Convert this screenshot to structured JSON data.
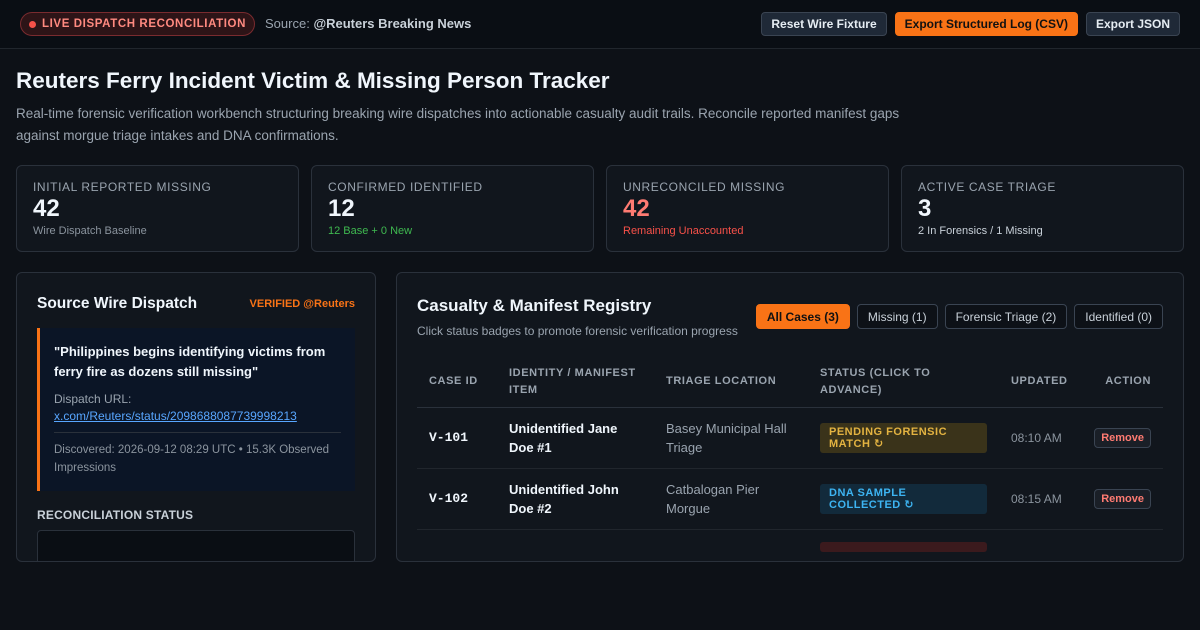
{
  "topbar": {
    "live_label": "LIVE DISPATCH RECONCILIATION",
    "source_prefix": "Source:",
    "source_handle": "@Reuters Breaking News",
    "buttons": {
      "reset": "Reset Wire Fixture",
      "export_csv": "Export Structured Log (CSV)",
      "export_json": "Export JSON"
    }
  },
  "header": {
    "title": "Reuters Ferry Incident Victim & Missing Person Tracker",
    "description": "Real-time forensic verification workbench structuring breaking wire dispatches into actionable casualty audit trails. Reconcile reported manifest gaps against morgue triage intakes and DNA confirmations."
  },
  "stats": [
    {
      "label": "Initial Reported Missing",
      "value": "42",
      "sub": "Wire Dispatch Baseline"
    },
    {
      "label": "Confirmed Identified",
      "value": "12",
      "sub": "12 Base + 0 New"
    },
    {
      "label": "Unreconciled Missing",
      "value": "42",
      "sub": "Remaining Unaccounted"
    },
    {
      "label": "Active Case Triage",
      "value": "3",
      "sub": "2 In Forensics / 1 Missing"
    }
  ],
  "dispatch": {
    "title": "Source Wire Dispatch",
    "verified": "VERIFIED @Reuters",
    "quote": "\"Philippines begins identifying victims from ferry fire as dozens still missing\"",
    "url_label": "Dispatch URL:",
    "url": "x.com/Reuters/status/2098688087739998213",
    "discovered": "Discovered: 2026-09-12 08:29 UTC • 15.3K Observed Impressions",
    "recon_label": "RECONCILIATION STATUS"
  },
  "registry": {
    "title": "Casualty & Manifest Registry",
    "subtitle": "Click status badges to promote forensic verification progress",
    "filters": [
      "All Cases (3)",
      "Missing (1)",
      "Forensic Triage (2)",
      "Identified (0)"
    ],
    "columns": [
      "Case ID",
      "Identity / Manifest Item",
      "Triage Location",
      "Status (Click to Advance)",
      "Updated",
      "Action"
    ],
    "rows": [
      {
        "id": "V-101",
        "identity": "Unidentified Jane Doe #1",
        "location": "Basey Municipal Hall Triage",
        "status": "PENDING FORENSIC MATCH ↻",
        "updated": "08:10 AM",
        "action": "Remove"
      },
      {
        "id": "V-102",
        "identity": "Unidentified John Doe #2",
        "location": "Catbalogan Pier Morgue",
        "status": "DNA SAMPLE COLLECTED ↻",
        "updated": "08:15 AM",
        "action": "Remove"
      }
    ]
  },
  "colors": {
    "accent": "#f97316",
    "danger": "#f85149",
    "success": "#3fb950",
    "link": "#58a6ff",
    "background": "#0d1117"
  }
}
